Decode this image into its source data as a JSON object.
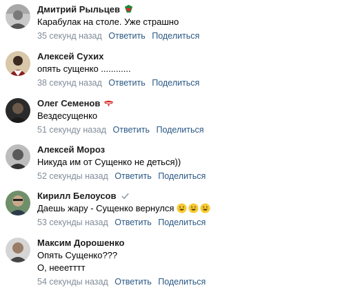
{
  "comments": [
    {
      "author": "Дмитрий Рыльцев",
      "badge": "loko-club-badge",
      "lines": [
        "Карабулак на столе. Уже страшно"
      ],
      "time": "35 секунд назад",
      "reply": "Ответить",
      "share": "Поделиться"
    },
    {
      "author": "Алексей Сухих",
      "badge": "",
      "lines": [
        "опять сущенко ............"
      ],
      "time": "38 секунд назад",
      "reply": "Ответить",
      "share": "Поделиться"
    },
    {
      "author": "Олег Семенов",
      "badge": "spartak-club-badge",
      "lines": [
        "Вездесущенко"
      ],
      "time": "51 секунду назад",
      "reply": "Ответить",
      "share": "Поделиться"
    },
    {
      "author": "Алексей Мороз",
      "badge": "",
      "lines": [
        "Никуда им от Сущенко не деться))"
      ],
      "time": "52 секунды назад",
      "reply": "Ответить",
      "share": "Поделиться"
    },
    {
      "author": "Кирилл Белоусов",
      "badge": "verified-check",
      "lines": [
        "Даешь жару - Сущенко вернулся"
      ],
      "emoji_count": 3,
      "time": "53 секунды назад",
      "reply": "Ответить",
      "share": "Поделиться"
    },
    {
      "author": "Максим Дорошенко",
      "badge": "",
      "lines": [
        "Опять Сущенко???",
        "О, нееетттт"
      ],
      "time": "54 секунды назад",
      "reply": "Ответить",
      "share": "Поделиться"
    }
  ],
  "colors": {
    "link": "#2a5885",
    "meta": "#818c99",
    "author": "#1c1c1c"
  }
}
